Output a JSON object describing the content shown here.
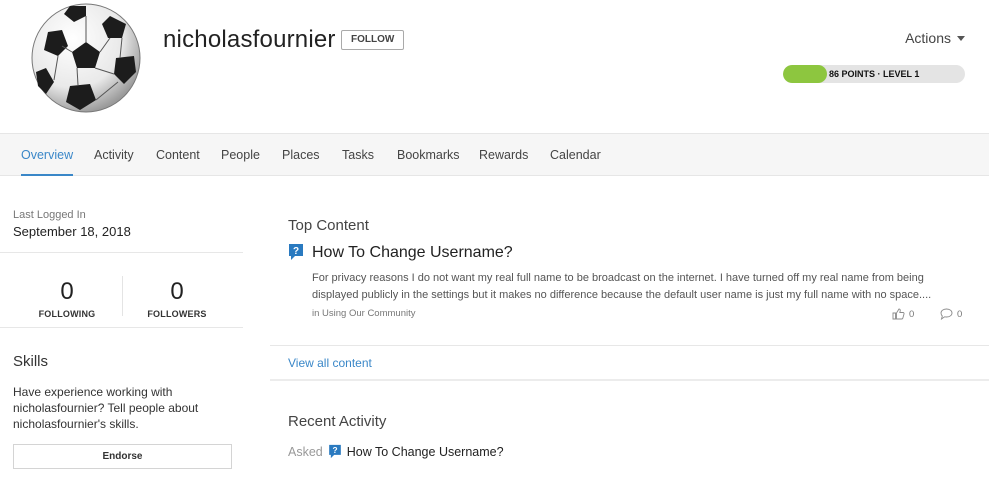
{
  "profile": {
    "username": "nicholasfournier",
    "follow_label": "FOLLOW",
    "actions_label": "Actions",
    "points": {
      "text": "86 POINTS · LEVEL 1",
      "fill_fraction": 0.24,
      "color": "#8dc63f"
    },
    "avatar_icon": "soccer-ball-icon"
  },
  "tabs": [
    {
      "label": "Overview",
      "active": true
    },
    {
      "label": "Activity"
    },
    {
      "label": "Content"
    },
    {
      "label": "People"
    },
    {
      "label": "Places"
    },
    {
      "label": "Tasks"
    },
    {
      "label": "Bookmarks"
    },
    {
      "label": "Rewards"
    },
    {
      "label": "Calendar"
    }
  ],
  "sidebar": {
    "last_logged_label": "Last Logged In",
    "last_logged_value": "September 18, 2018",
    "following": {
      "count": "0",
      "label": "FOLLOWING"
    },
    "followers": {
      "count": "0",
      "label": "FOLLOWERS"
    },
    "skills_title": "Skills",
    "skills_text": "Have experience working with nicholasfournier? Tell people about nicholasfournier's skills.",
    "endorse_label": "Endorse"
  },
  "top_content": {
    "title": "Top Content",
    "item": {
      "icon": "question-icon",
      "title": "How To Change Username?",
      "excerpt": "For privacy reasons I do not want my real full name to be broadcast on the internet. I have turned off my real name from being displayed publicly in the settings but it makes no difference because the default user name is just my full name with no space....",
      "meta_prefix": "in",
      "meta_place": "Using Our Community",
      "likes": "0",
      "comments": "0"
    },
    "view_all_label": "View all content"
  },
  "recent_activity": {
    "title": "Recent Activity",
    "asked_label": "Asked",
    "item_title": "How To Change Username?"
  },
  "colors": {
    "accent": "#3a87c8",
    "points_green": "#8dc63f",
    "question_blue": "#2a7ac0"
  }
}
